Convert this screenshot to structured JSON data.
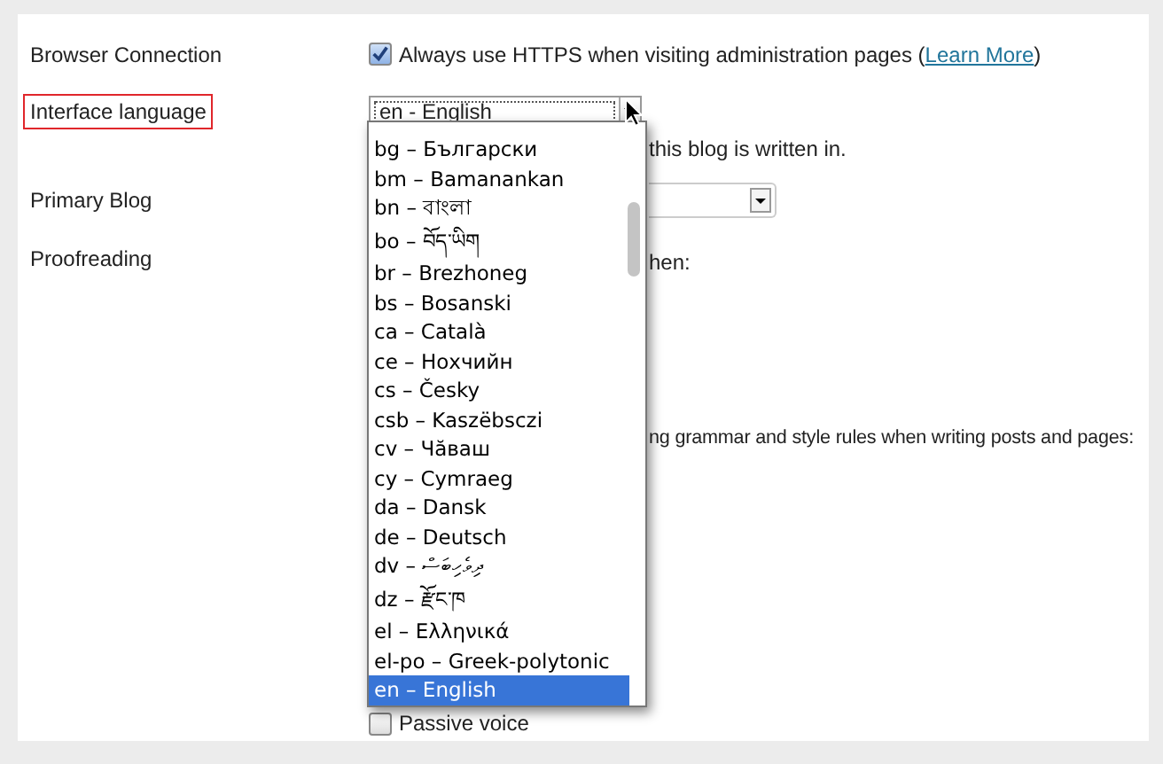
{
  "rows": [
    {
      "label": "Browser Connection",
      "highlighted": false,
      "checkbox": {
        "checked": true,
        "text": "Always use HTTPS when visiting administration pages (",
        "link": "Learn More",
        "text_after": ")"
      }
    },
    {
      "label": "Interface language",
      "highlighted": true,
      "select": {
        "value": "en - English"
      },
      "note": "this blog is written in."
    },
    {
      "label": "Primary Blog",
      "highlighted": false
    },
    {
      "label": "Proofreading",
      "highlighted": false,
      "note": "hen:",
      "note2": "ng grammar and style rules when writing posts and pages:",
      "option": {
        "label": "Passive voice",
        "checked": false
      }
    }
  ],
  "dropdown": {
    "items": [
      {
        "label": "bg – Български",
        "selected": false
      },
      {
        "label": "bm – Bamanankan",
        "selected": false
      },
      {
        "label": "bn – বাংলা",
        "selected": false
      },
      {
        "label": "bo – བོད་ཡིག",
        "selected": false
      },
      {
        "label": "br – Brezhoneg",
        "selected": false
      },
      {
        "label": "bs – Bosanski",
        "selected": false
      },
      {
        "label": "ca – Català",
        "selected": false
      },
      {
        "label": "ce – Нохчийн",
        "selected": false
      },
      {
        "label": "cs – Česky",
        "selected": false
      },
      {
        "label": "csb – Kaszëbsczi",
        "selected": false
      },
      {
        "label": "cv – Чăваш",
        "selected": false
      },
      {
        "label": "cy – Cymraeg",
        "selected": false
      },
      {
        "label": "da – Dansk",
        "selected": false
      },
      {
        "label": "de – Deutsch",
        "selected": false
      },
      {
        "label": "dv – ދިވެހިބަސް",
        "selected": false
      },
      {
        "label": "dz – རྫོང་ཁ",
        "selected": false
      },
      {
        "label": "el – Ελληνικά",
        "selected": false
      },
      {
        "label": "el-po – Greek-polytonic",
        "selected": false
      },
      {
        "label": "en – English",
        "selected": true
      }
    ]
  }
}
